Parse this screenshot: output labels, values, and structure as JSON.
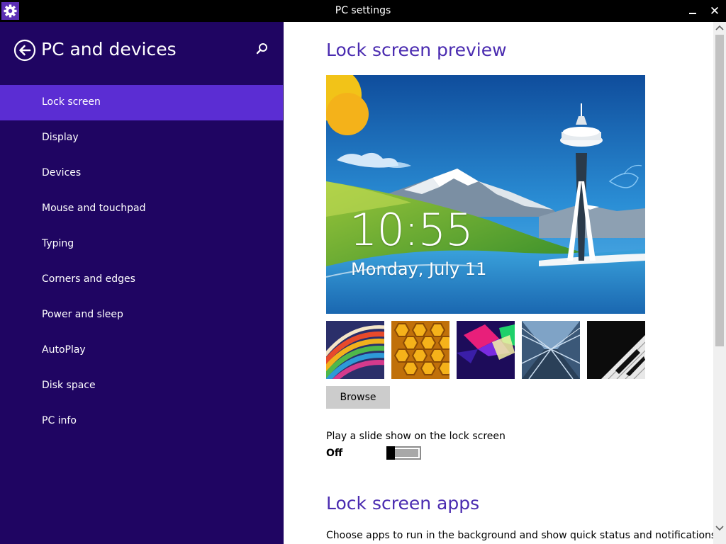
{
  "window": {
    "title": "PC settings",
    "icon": "gear-icon",
    "minimize_icon": "minimize-icon",
    "close_icon": "close-icon",
    "close_glyph": "✕"
  },
  "sidebar": {
    "back_icon": "back-arrow-icon",
    "title": "PC and devices",
    "search_icon": "search-icon",
    "items": [
      {
        "label": "Lock screen",
        "selected": true
      },
      {
        "label": "Display",
        "selected": false
      },
      {
        "label": "Devices",
        "selected": false
      },
      {
        "label": "Mouse and touchpad",
        "selected": false
      },
      {
        "label": "Typing",
        "selected": false
      },
      {
        "label": "Corners and edges",
        "selected": false
      },
      {
        "label": "Power and sleep",
        "selected": false
      },
      {
        "label": "AutoPlay",
        "selected": false
      },
      {
        "label": "Disk space",
        "selected": false
      },
      {
        "label": "PC info",
        "selected": false
      }
    ]
  },
  "main": {
    "preview_title": "Lock screen preview",
    "preview_time": "10:55",
    "preview_date": "Monday, July 11",
    "thumbnails": [
      "ribbons-wallpaper",
      "honeycomb-wallpaper",
      "neon-shapes-wallpaper",
      "escalator-wallpaper",
      "piano-keys-wallpaper"
    ],
    "browse_label": "Browse",
    "slideshow_label": "Play a slide show on the lock screen",
    "slideshow_state": "Off",
    "slideshow_on": false,
    "apps_title": "Lock screen apps",
    "apps_description": "Choose apps to run in the background and show quick status and notifications,"
  },
  "colors": {
    "sidebar_bg": "#1f0562",
    "selected_item": "#5b2dd3",
    "accent_heading": "#4a2bb0",
    "titlebar_bg": "#000000",
    "button_bg": "#cccccc"
  }
}
